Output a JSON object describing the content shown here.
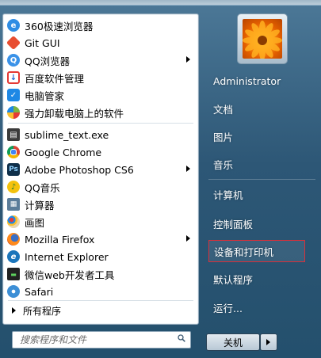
{
  "start_menu": {
    "programs": [
      {
        "label": "360极速浏览器",
        "icon": "browser-360-icon",
        "color": "#2f8de4"
      },
      {
        "label": "Git GUI",
        "icon": "git-icon",
        "color": "#e84e31"
      },
      {
        "label": "QQ浏览器",
        "icon": "qq-browser-icon",
        "color": "#3a92e8",
        "submenu": true
      },
      {
        "label": "百度软件管理",
        "icon": "baidu-icon",
        "color": "#e53935"
      },
      {
        "label": "电脑管家",
        "icon": "pc-manager-icon",
        "color": "#1e88e5"
      },
      {
        "label": "强力卸载电脑上的软件",
        "icon": "uninstall-icon",
        "color": "#7cb342"
      },
      {
        "label": "sublime_text.exe",
        "icon": "sublime-icon",
        "color": "#3b3b3b"
      },
      {
        "label": "Google Chrome",
        "icon": "chrome-icon",
        "color": "#4caf50"
      },
      {
        "label": "Adobe Photoshop CS6",
        "icon": "photoshop-icon",
        "color": "#0f2f4a",
        "submenu": true
      },
      {
        "label": "QQ音乐",
        "icon": "qq-music-icon",
        "color": "#f4c20d"
      },
      {
        "label": "计算器",
        "icon": "calculator-icon",
        "color": "#5b7d9a"
      },
      {
        "label": "画图",
        "icon": "paint-icon",
        "color": "#d08a2f"
      },
      {
        "label": "Mozilla Firefox",
        "icon": "firefox-icon",
        "color": "#e66000",
        "submenu": true
      },
      {
        "label": "Internet Explorer",
        "icon": "ie-icon",
        "color": "#1b75bb"
      },
      {
        "label": "微信web开发者工具",
        "icon": "wechat-devtools-icon",
        "color": "#222222"
      },
      {
        "label": "Safari",
        "icon": "safari-icon",
        "color": "#3d8fd6"
      }
    ],
    "all_programs": "所有程序",
    "search": {
      "placeholder": "搜索程序和文件"
    },
    "right_items": [
      {
        "label": "Administrator"
      },
      {
        "label": "文档"
      },
      {
        "label": "图片"
      },
      {
        "label": "音乐"
      },
      {
        "label": "计算机"
      },
      {
        "label": "控制面板"
      },
      {
        "label": "设备和打印机",
        "highlighted": true
      },
      {
        "label": "默认程序"
      },
      {
        "label": "运行..."
      }
    ],
    "shutdown": {
      "label": "关机"
    }
  }
}
